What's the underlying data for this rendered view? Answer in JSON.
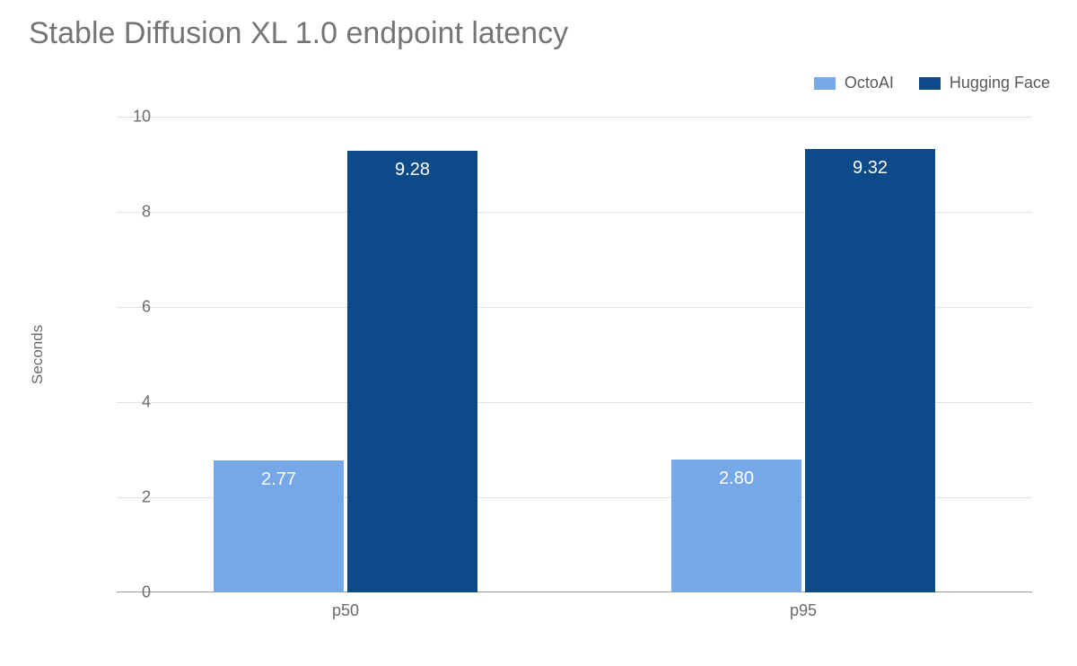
{
  "chart_data": {
    "type": "bar",
    "title": "Stable Diffusion XL 1.0 endpoint latency",
    "ylabel": "Seconds",
    "xlabel": "",
    "ylim": [
      0,
      10
    ],
    "yticks": [
      0,
      2,
      4,
      6,
      8,
      10
    ],
    "categories": [
      "p50",
      "p95"
    ],
    "series": [
      {
        "name": "OctoAI",
        "color": "#76a7e8",
        "values": [
          2.77,
          2.8
        ]
      },
      {
        "name": "Hugging Face",
        "color": "#0d4a8a",
        "values": [
          9.28,
          9.32
        ]
      }
    ],
    "value_labels": {
      "OctoAI": [
        "2.77",
        "2.80"
      ],
      "Hugging Face": [
        "9.28",
        "9.32"
      ]
    },
    "legend_position": "top-right"
  }
}
